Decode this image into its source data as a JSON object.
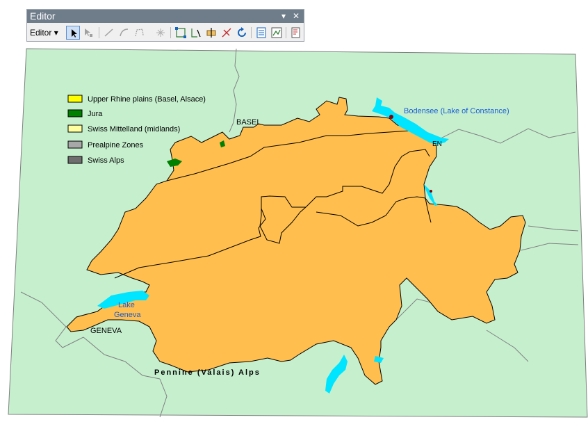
{
  "toolbar": {
    "title": "Editor",
    "editor_menu_label": "Editor",
    "pin_icon": "dropdown-arrow",
    "close_icon": "close"
  },
  "legend": {
    "items": [
      {
        "label": "Upper Rhine plains (Basel, Alsace)",
        "color": "#ffff00"
      },
      {
        "label": "Jura",
        "color": "#008000"
      },
      {
        "label": "Swiss Mittelland (midlands)",
        "color": "#ffffa0"
      },
      {
        "label": "Prealpine Zones",
        "color": "#a8a8a8"
      },
      {
        "label": "Swiss Alps",
        "color": "#6e6e6e"
      }
    ]
  },
  "labels": {
    "bodensee": "Bodensee (Lake of Constance)",
    "basel": "BASEL",
    "lake_geneva_1": "Lake",
    "lake_geneva_2": "Geneva",
    "geneva": "GENEVA",
    "pennine": "Pennine (Valais) Alps",
    "edge_fragment": "EN"
  },
  "colors": {
    "background": "#c6efce",
    "switzerland": "#ffbe4d",
    "water": "#00e5ff",
    "border": "#808080",
    "label_blue": "#1a5fd6"
  }
}
